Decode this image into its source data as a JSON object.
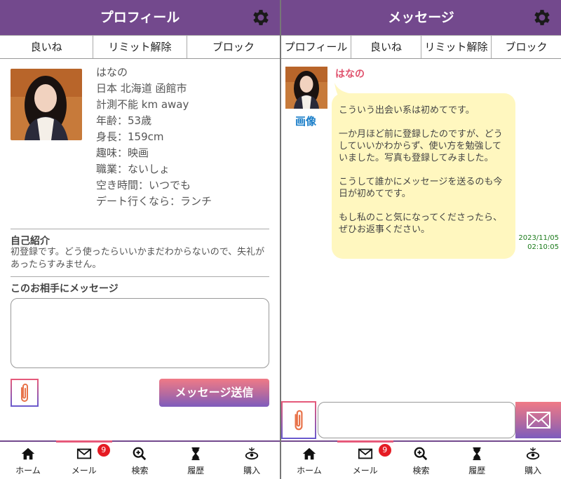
{
  "left": {
    "header_title": "プロフィール",
    "tabs": [
      "良いね",
      "リミット解除",
      "ブロック"
    ],
    "profile": {
      "name": "はなの",
      "location": "日本 北海道 函館市",
      "distance": "計測不能 km away",
      "age": "年齢：53歳",
      "height": "身長：159cm",
      "hobby": "趣味：映画",
      "job": "職業：ないしょ",
      "free_time": "空き時間：いつでも",
      "date": "デート行くなら：ランチ"
    },
    "intro_title": "自己紹介",
    "intro_text": "初登録です。どう使ったらいいかまだわからないので、失礼があったらすみません。",
    "message_title": "このお相手にメッセージ",
    "send_label": "メッセージ送信"
  },
  "right": {
    "header_title": "メッセージ",
    "tabs": [
      "プロフィール",
      "良いね",
      "リミット解除",
      "ブロック"
    ],
    "sender": "はなの",
    "image_label": "画像",
    "message": [
      "こういう出会い系は初めてです。",
      "一か月ほど前に登録したのですが、どうしていいかわからず、使い方を勉強していました。写真も登録してみました。",
      "こうして誰かにメッセージを送るのも今日が初めてです。",
      "もし私のこと気になってくださったら、ぜひお返事ください。"
    ],
    "timestamp_date": "2023/11/05",
    "timestamp_time": "02:10:05"
  },
  "nav": {
    "items": [
      "ホーム",
      "メール",
      "検索",
      "履歴",
      "購入"
    ],
    "mail_badge": "9"
  },
  "colors": {
    "header": "#73498d",
    "accent_pink": "#e0536e",
    "bubble": "#fff7bf",
    "badge": "#e51b23",
    "link": "#1c7fc9"
  }
}
